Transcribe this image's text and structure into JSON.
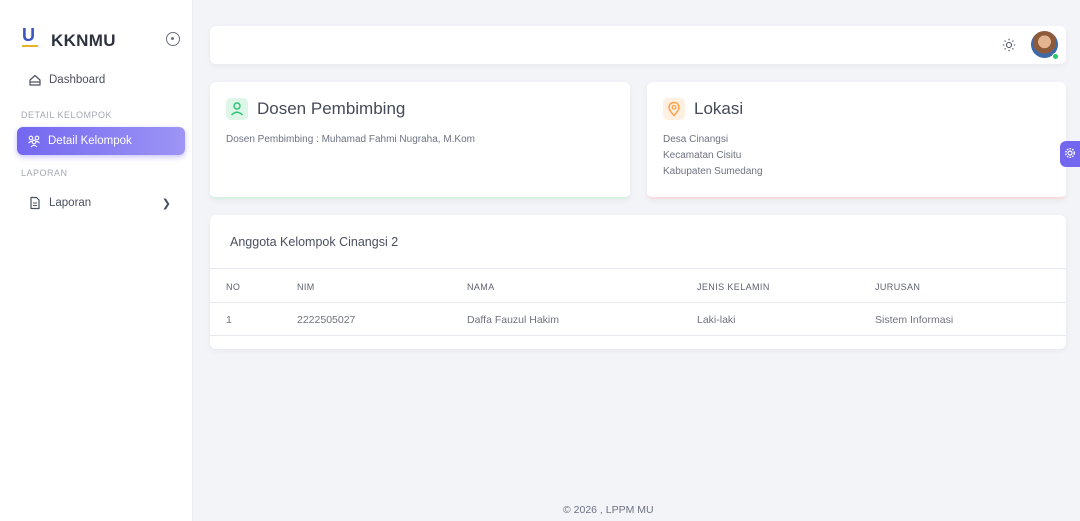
{
  "brand": {
    "name": "KKNMU"
  },
  "sidebar": {
    "dashboard": "Dashboard",
    "section1": "DETAIL KELOMPOK",
    "detail_kelompok": "Detail Kelompok",
    "section2": "LAPORAN",
    "laporan": "Laporan"
  },
  "dosen": {
    "title": "Dosen Pembimbing",
    "text": "Dosen Pembimbing : Muhamad Fahmi Nugraha, M.Kom"
  },
  "lokasi": {
    "title": "Lokasi",
    "desa": "Desa Cinangsi",
    "kecamatan": "Kecamatan Cisitu",
    "kabupaten": "Kabupaten Sumedang"
  },
  "table": {
    "title": "Anggota Kelompok Cinangsi 2",
    "headers": [
      "NO",
      "NIM",
      "NAMA",
      "JENIS KELAMIN",
      "JURUSAN"
    ],
    "rows": [
      [
        "1",
        "2222505027",
        "Daffa Fauzul Hakim",
        "Laki-laki",
        "Sistem Informasi"
      ]
    ]
  },
  "footer": "© 2026 , LPPM MU",
  "colors": {
    "accent": "#7367f0",
    "success": "#28c76f",
    "warning": "#ff9f43"
  },
  "icons": [
    "collapse-icon",
    "home-icon",
    "users-icon",
    "file-icon",
    "chevron-right-icon",
    "sun-icon",
    "user-icon",
    "location-pin-icon",
    "gear-icon"
  ]
}
